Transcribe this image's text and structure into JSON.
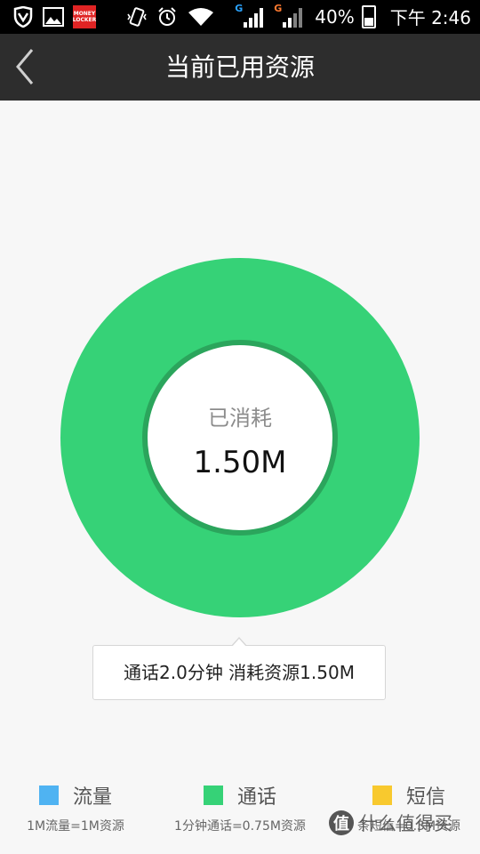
{
  "status_bar": {
    "battery_percent": "40%",
    "time": "下午 2:46",
    "money_locker_line1": "MONEY",
    "money_locker_line2": "LOCKER",
    "network_letter_1": "G",
    "network_letter_2": "G",
    "icons": [
      "shield-v-icon",
      "image-icon",
      "money-locker-icon",
      "vibrate-icon",
      "alarm-icon",
      "wifi-icon",
      "signal-icon",
      "signal-icon",
      "battery-charging-icon"
    ]
  },
  "header": {
    "title": "当前已用资源",
    "back_icon": "chevron-left-icon"
  },
  "donut": {
    "center_label": "已消耗",
    "center_value": "1.50M",
    "ring_color": "#36d277",
    "inner_border_color": "#2ba55c"
  },
  "tooltip": {
    "text": "通话2.0分钟 消耗资源1.50M"
  },
  "legend": [
    {
      "label": "流量",
      "desc": "1M流量=1M资源",
      "color": "#4fb3f2"
    },
    {
      "label": "通话",
      "desc": "1分钟通话=0.75M资源",
      "color": "#36d277"
    },
    {
      "label": "短信",
      "desc": "条短信=0.3M资源",
      "color": "#f8c92e"
    }
  ],
  "watermark": {
    "text": "什么值得买",
    "badge": "值"
  }
}
